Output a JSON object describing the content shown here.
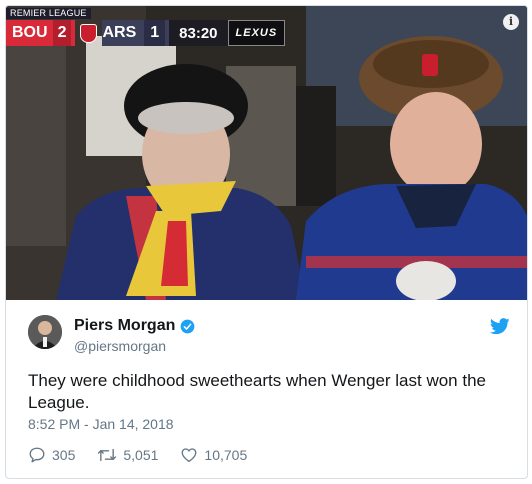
{
  "scoreboard": {
    "league": "REMIER LEAGUE",
    "home_team": "BOU",
    "home_score": "2",
    "away_team": "ARS",
    "away_score": "1",
    "clock": "83:20",
    "sponsor": "LEXUS"
  },
  "tweet": {
    "author_name": "Piers Morgan",
    "author_handle": "@piersmorgan",
    "text": "They were childhood sweethearts when Wenger last won the League.",
    "timestamp": "8:52 PM - Jan 14, 2018",
    "replies": "305",
    "retweets": "5,051",
    "likes": "10,705"
  },
  "colors": {
    "twitter_blue": "#1da1f2",
    "text_primary": "#14171a",
    "text_secondary": "#657786",
    "home_red": "#d92a3a"
  },
  "icons": [
    "info-icon",
    "verified-badge-icon",
    "twitter-bird-icon",
    "reply-icon",
    "retweet-icon",
    "like-icon"
  ]
}
